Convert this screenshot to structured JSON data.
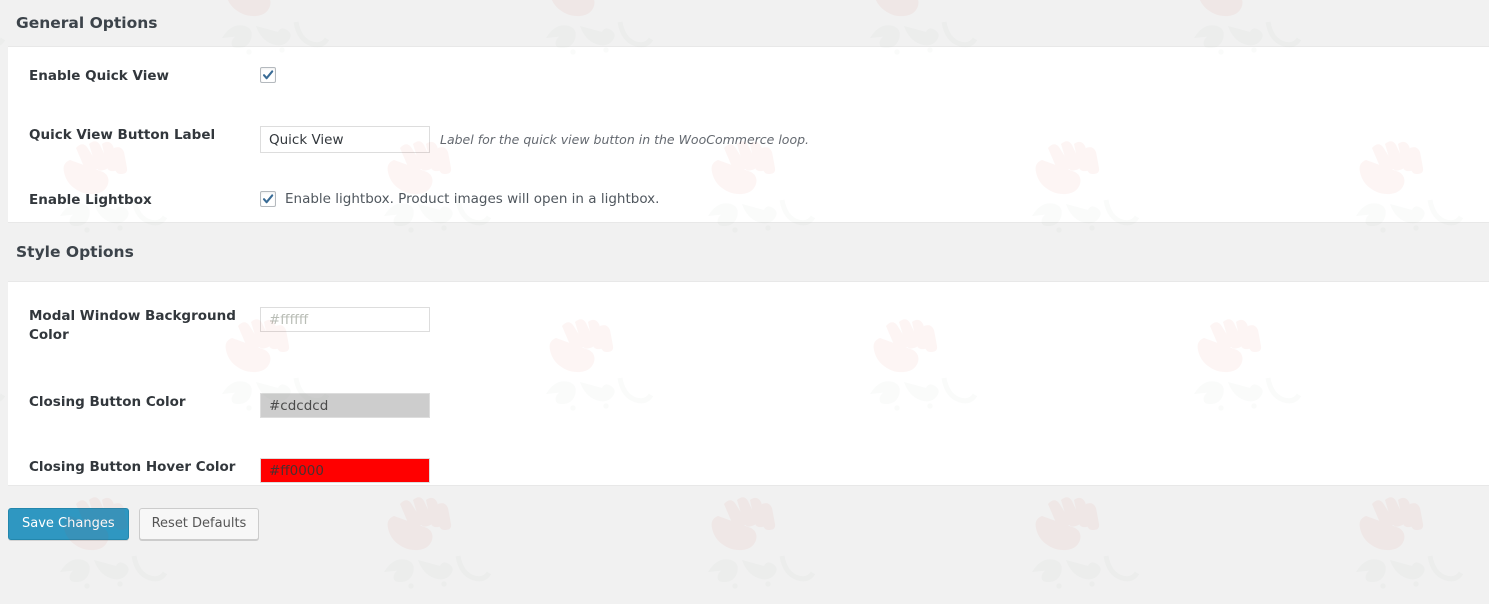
{
  "sections": [
    {
      "id": "general",
      "title": "General Options",
      "rows": [
        {
          "label": "Enable Quick View",
          "type": "checkbox",
          "checked": true,
          "inline_label": ""
        },
        {
          "label": "Quick View Button Label",
          "type": "text",
          "value": "Quick View",
          "placeholder": "Quick View",
          "description": "Label for the quick view button in the WooCommerce loop."
        },
        {
          "label": "Enable Lightbox",
          "type": "checkbox",
          "checked": true,
          "inline_label": "Enable lightbox. Product images will open in a lightbox."
        }
      ]
    },
    {
      "id": "style",
      "title": "Style Options",
      "rows": [
        {
          "label": "Modal Window Background Color",
          "type": "color",
          "value": "#ffffff",
          "swatch": "#ffffff",
          "text_color": "#b9bdb6"
        },
        {
          "label": "Closing Button Color",
          "type": "color",
          "value": "#cdcdcd",
          "swatch": "#cdcdcd",
          "text_color": "#4a4a4a"
        },
        {
          "label": "Closing Button Hover Color",
          "type": "color",
          "value": "#ff0000",
          "swatch": "#ff0000",
          "text_color": "#4a3030"
        }
      ]
    }
  ],
  "footer": {
    "save_label": "Save Changes",
    "reset_label": "Reset Defaults"
  },
  "colors": {
    "accent": "#2f97c1",
    "page_background": "#f1f1f1",
    "panel_background": "#ffffff",
    "checkbox_check": "#3a6c96",
    "heading_text": "#3c434a"
  },
  "icons": {
    "checkmark": "check-icon"
  }
}
